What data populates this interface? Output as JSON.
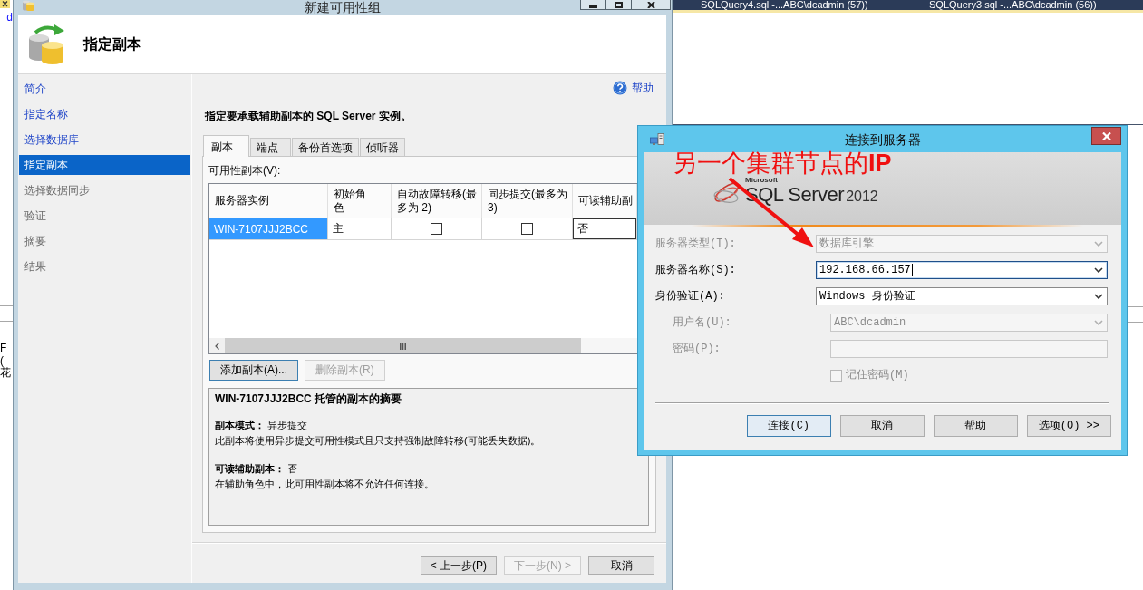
{
  "background_app": {
    "tabs": [
      "SQLQuery4.sql -...ABC\\dcadmin (57))",
      "SQLQuery3.sql -...ABC\\dcadmin (56))"
    ],
    "editor_lines": [
      "d"
    ],
    "pane_lines": [
      "F",
      "(",
      "花"
    ]
  },
  "wizard": {
    "title": "新建可用性组",
    "page_title": "指定副本",
    "steps": [
      {
        "label": "简介",
        "selected": false,
        "disabled": false
      },
      {
        "label": "指定名称",
        "selected": false,
        "disabled": false
      },
      {
        "label": "选择数据库",
        "selected": false,
        "disabled": false
      },
      {
        "label": "指定副本",
        "selected": true,
        "disabled": false
      },
      {
        "label": "选择数据同步",
        "selected": false,
        "disabled": true
      },
      {
        "label": "验证",
        "selected": false,
        "disabled": true
      },
      {
        "label": "摘要",
        "selected": false,
        "disabled": true
      },
      {
        "label": "结果",
        "selected": false,
        "disabled": true
      }
    ],
    "help_link": "帮助",
    "instruction": "指定要承载辅助副本的 SQL Server 实例。",
    "tabs": [
      {
        "label": "副本",
        "selected": true
      },
      {
        "label": "端点",
        "selected": false
      },
      {
        "label": "备份首选项",
        "selected": false
      },
      {
        "label": "侦听器",
        "selected": false
      }
    ],
    "replicas_label": "可用性副本(V):",
    "grid": {
      "columns": [
        {
          "label": "服务器实例",
          "kind": "text"
        },
        {
          "label": "初始角色",
          "kind": "text"
        },
        {
          "label": "自动故障转移(最多为 2)",
          "kind": "checkbox"
        },
        {
          "label": "同步提交(最多为 3)",
          "kind": "checkbox"
        },
        {
          "label": "可读辅助副",
          "kind": "combo"
        }
      ],
      "rows": [
        {
          "cells": [
            {
              "value": "WIN-7107JJJ2BCC",
              "selected": true
            },
            {
              "value": "主",
              "selected": false
            },
            {
              "checked": false,
              "selected": false
            },
            {
              "checked": false,
              "selected": false
            },
            {
              "value": "否",
              "selected": false
            }
          ]
        }
      ]
    },
    "grid_buttons": [
      {
        "label": "添加副本(A)...",
        "disabled": false,
        "focused": true
      },
      {
        "label": "删除副本(R)",
        "disabled": true,
        "focused": false
      }
    ],
    "summary": {
      "title": "WIN-7107JJJ2BCC 托管的副本的摘要",
      "sections": [
        {
          "heading": "**副本模式：** 异步提交",
          "description": "此副本将使用异步提交可用性模式且只支持强制故障转移(可能丢失数据)。"
        },
        {
          "heading": "**可读辅助副本：** 否",
          "description": "在辅助角色中，此可用性副本将不允许任何连接。"
        }
      ]
    },
    "nav_buttons": [
      {
        "label": "< 上一步(P)",
        "disabled": false
      },
      {
        "label": "下一步(N) >",
        "disabled": true
      },
      {
        "label": "取消",
        "disabled": false
      }
    ]
  },
  "connect_dialog": {
    "title": "连接到服务器",
    "logo": {
      "brand": "Microsoft",
      "product": "SQL Server",
      "version": "2012"
    },
    "fields": [
      {
        "kind": "combo",
        "label": "服务器类型(T):",
        "value": "数据库引擎",
        "disabled": true,
        "focused": false
      },
      {
        "kind": "combo",
        "label": "服务器名称(S):",
        "value": "192.168.66.157",
        "disabled": false,
        "focused": true
      },
      {
        "kind": "combo",
        "label": "身份验证(A):",
        "value": "Windows 身份验证",
        "disabled": false,
        "focused": false,
        "children": [
          {
            "kind": "combo",
            "label": "用户名(U):",
            "value": "ABC\\dcadmin",
            "disabled": true,
            "focused": false
          },
          {
            "kind": "text",
            "label": "密码(P):",
            "disabled": true,
            "focused": false
          },
          {
            "kind": "checkbox",
            "label": "记住密码(M)",
            "checked": false,
            "disabled": true
          }
        ]
      }
    ],
    "buttons": [
      {
        "label": "连接(C)",
        "default": true
      },
      {
        "label": "取消",
        "default": false
      },
      {
        "label": "帮助",
        "default": false
      },
      {
        "label": "选项(O) >>",
        "default": false
      }
    ]
  },
  "annotation": {
    "text": "另一个集群节点的**IP**"
  }
}
